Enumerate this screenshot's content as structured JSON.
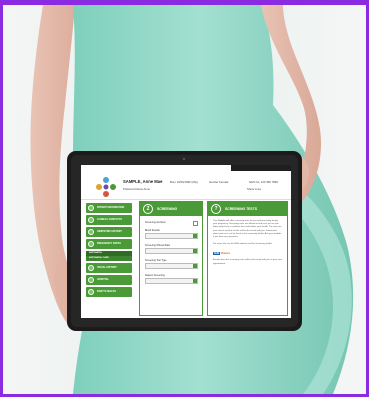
{
  "colors": {
    "accent": "#4a9a37",
    "frame": "#8a2be2",
    "dress": "#94d9c8"
  },
  "header": {
    "patient_name": "SAMPLE, Anne Mae",
    "dob": "Born 19/06/1990 (29y)",
    "gender": "Gender Female",
    "nhs": "NHS No. 123 456 7890",
    "preferred_name": "Preferred Name Anne",
    "more": "Show more"
  },
  "sidebar": {
    "items": [
      {
        "label": "PATIENT INFORMATION",
        "icon": "person-icon"
      },
      {
        "label": "CLINICAL CONTACTS",
        "icon": "contacts-icon"
      },
      {
        "label": "OBSTETRIC HISTORY",
        "icon": "history-icon"
      },
      {
        "label": "PREGNANCY DATES",
        "icon": "calendar-icon"
      }
    ],
    "section_label": "ANTENATAL",
    "sub_label": "ANTENATAL CARE",
    "items2": [
      {
        "label": "VISUAL HISTORY",
        "icon": "eye-icon"
      },
      {
        "label": "HOSPITAL",
        "icon": "hospital-icon"
      },
      {
        "label": "BABY'S HEALTH",
        "icon": "baby-icon"
      }
    ]
  },
  "screening": {
    "number": "2",
    "title": "SCREENING",
    "fields": [
      "Screening declined",
      "Blood Results",
      "Screening Offered Date",
      "Screening Test Type",
      "Reason Screening"
    ]
  },
  "tests": {
    "number": "?",
    "title": "SCREENING TESTS",
    "text": "Your Midwife will offer screening tests for you and your baby during your pregnancy. Screening tests are offered to find out if you or your baby might have a condition that could affect your health. The tests are your choice and the results will be discussed with you. Information about each test can be found in the screening leaflet. Ask your midwife if you have any questions.",
    "text2": "For more info see the NHS website and the Screening leaflet.",
    "link": "NHS",
    "link_suffix": "Choices",
    "footer": "Results from the screening tests will be discussed with you at your next appointment."
  }
}
